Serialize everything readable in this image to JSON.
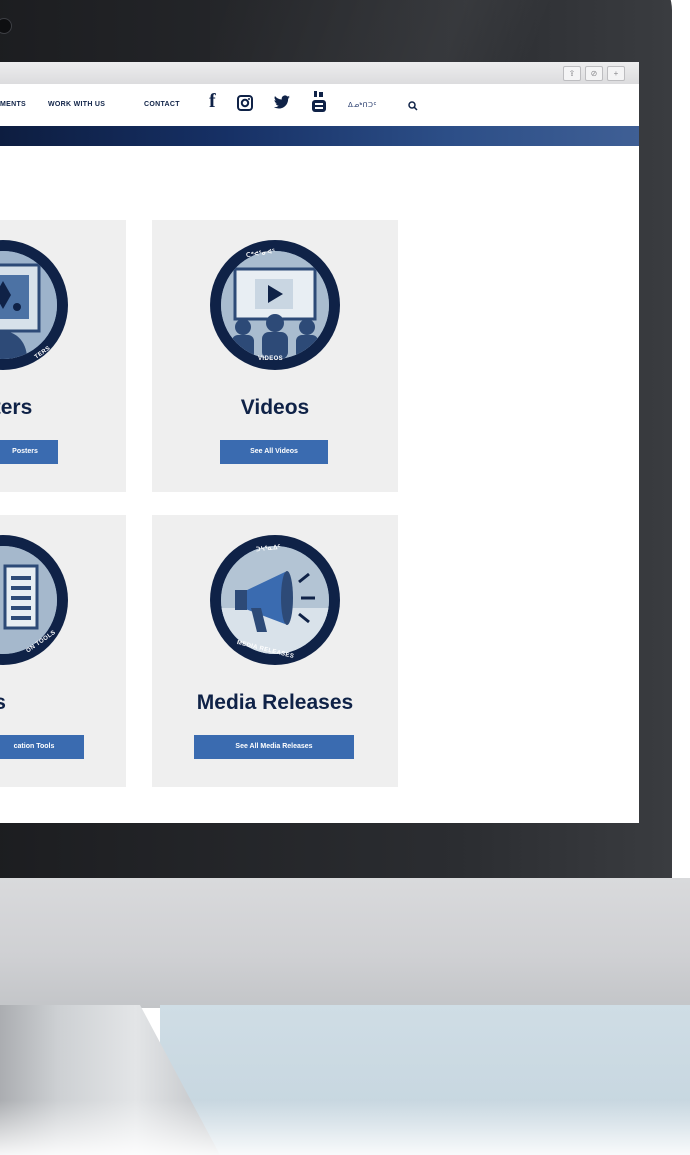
{
  "browser": {
    "buttons": [
      "⇪",
      "⊘",
      "+"
    ]
  },
  "nav": {
    "items": [
      {
        "label": "MENTS"
      },
      {
        "label": "WORK WITH US"
      },
      {
        "label": "CONTACT"
      }
    ],
    "social": [
      "facebook-icon",
      "instagram-icon",
      "twitter-icon",
      "youtube-icon"
    ],
    "language_label": "ᐃᓄᒃᑎᑐᑦ",
    "search_icon": "search-icon"
  },
  "colors": {
    "navy": "#0f2247",
    "button_blue": "#3a6bb0",
    "card_bg": "#efefef"
  },
  "cards": [
    {
      "title": "ters",
      "button": "Posters",
      "badge_bottom": "TERS",
      "icon": "posters-icon"
    },
    {
      "title": "Videos",
      "button": "See All Videos",
      "badge_top": "ᑕᕝᕙᕐᓂᐊᕐ",
      "badge_bottom": "VIDEOS",
      "icon": "video-play-icon"
    },
    {
      "title": "on Tools",
      "button": "cation Tools",
      "badge_bottom": "ON TOOLS",
      "icon": "document-icon"
    },
    {
      "title": "Media Releases",
      "button": "See All Media Releases",
      "badge_top": "ᑐᓴᕐᓇᐃᑦ",
      "badge_bottom": "MEDIA RELEASES",
      "icon": "megaphone-icon"
    }
  ]
}
